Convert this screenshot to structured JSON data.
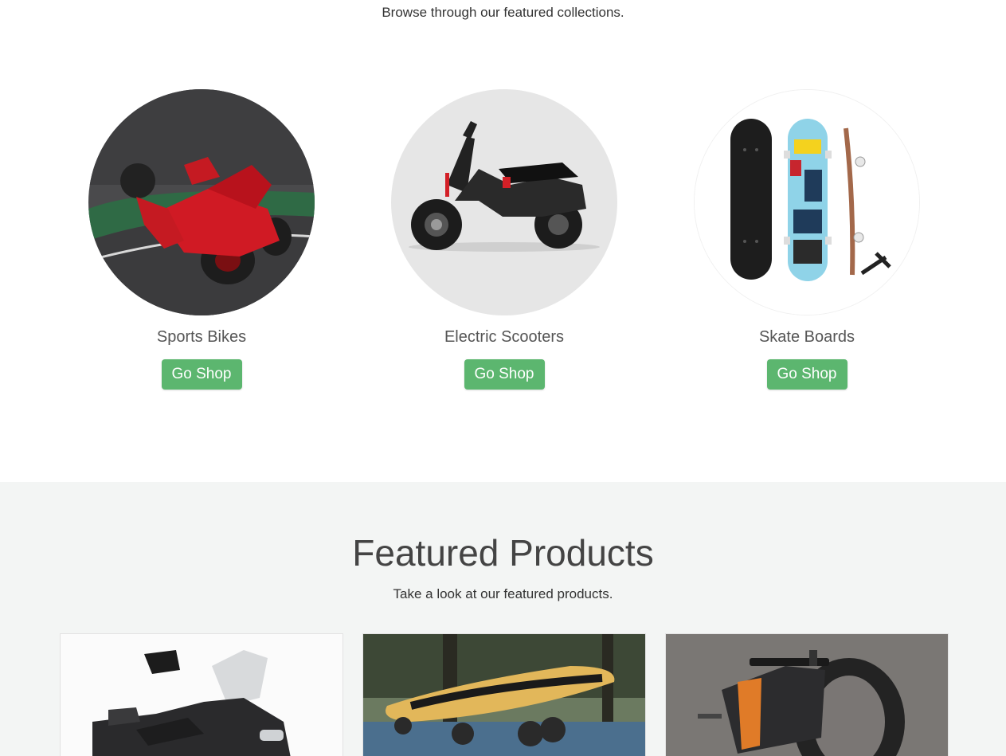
{
  "collections": {
    "subtitle": "Browse through our featured collections.",
    "items": [
      {
        "name": "Sports Bikes",
        "button": "Go Shop",
        "image": "sports-bike-rider"
      },
      {
        "name": "Electric Scooters",
        "button": "Go Shop",
        "image": "electric-scooter"
      },
      {
        "name": "Skate Boards",
        "button": "Go Shop",
        "image": "skateboards"
      }
    ]
  },
  "featured": {
    "title": "Featured Products",
    "subtitle": "Take a look at our featured products.",
    "products": [
      {
        "image": "maxi-scooter"
      },
      {
        "image": "longboard"
      },
      {
        "image": "electric-motorcycle"
      }
    ]
  },
  "colors": {
    "button_green": "#5cb66f",
    "featured_background": "#f3f5f4"
  }
}
